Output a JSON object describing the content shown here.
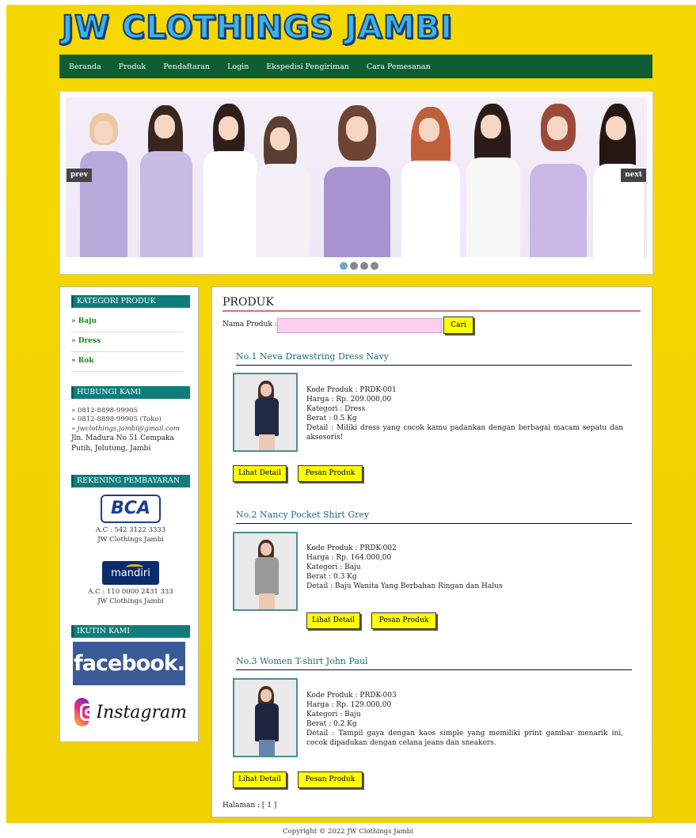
{
  "site": {
    "logo": "JW CLOTHINGS JAMBI"
  },
  "nav": {
    "items": [
      "Beranda",
      "Produk",
      "Pendaftaran",
      "Login",
      "Ekspedisi Pengiriman",
      "Cara Pemesanan"
    ]
  },
  "slider": {
    "prev_label": "prev",
    "next_label": "next",
    "slide_count": 4,
    "active_slide": 1
  },
  "sidebar": {
    "category_heading": "KATEGORI PRODUK",
    "categories": [
      "» Baju",
      "» Dress",
      "» Rok"
    ],
    "contact_heading": "HUBUNGI KAMI",
    "phone1": "» 0812-8898-99905",
    "phone2": "» 0812-8898-99905 (Toko)",
    "email": "» jwclothings.jambi@gmail.com",
    "address": "Jln. Madura No 51 Cempaka Putih, Jelutung, Jambi",
    "bank_heading": "REKENING PEMBAYARAN",
    "bca_logo": "BCA",
    "bca_account": "A.C : 542 3122 3333",
    "bca_name": "JW Clothings Jambi",
    "mandiri_logo": "mandiri",
    "mandiri_account": "A.C : 110 0000 2431 333",
    "mandiri_name": "JW Clothings Jambi",
    "follow_heading": "IKUTIN KAMI",
    "facebook_logo": "facebook.",
    "instagram_logo": "Instagram"
  },
  "main": {
    "title": "PRODUK",
    "search_label": "Nama Produk :",
    "search_value": "",
    "search_button": "Cari",
    "detail_button": "Lihat Detail",
    "order_button": "Pesan Produk",
    "pagination": "Halaman : [ 1 ]",
    "products": [
      {
        "title": "No.1 Neva Drawstring Dress Navy",
        "kode": "Kode Produk : PRDK-001",
        "harga": "Harga : Rp. 209.000,00",
        "kategori": "Kategori : Dress",
        "berat": "Berat : 0.5 Kg",
        "detail": "Detail : Miliki dress yang cocok kamu padankan dengan berbagai macam sepatu dan aksesoris!",
        "color": "#1f2a44"
      },
      {
        "title": "No.2 Nancy Pocket Shirt Grey",
        "kode": "Kode Produk : PRDK-002",
        "harga": "Harga : Rp. 164.000,00",
        "kategori": "Kategori : Baju",
        "berat": "Berat : 0.3 Kg",
        "detail": "Detail : Baju Wanita Yang Berbahan Ringan dan Halus",
        "color": "#9a9a9a"
      },
      {
        "title": "No.3 Women T-shirt John Paul",
        "kode": "Kode Produk : PRDK-003",
        "harga": "Harga : Rp. 129.000,00",
        "kategori": "Kategori : Baju",
        "berat": "Berat : 0.2 Kg",
        "detail": "Detail : Tampil gaya dengan kaos simple yang memiliki print gambar menarik ini, cocok dipadukan dengan celana jeans dan sneakers.",
        "color": "#1d2540"
      }
    ]
  },
  "footer": {
    "copyright": "Copyright © 2022 JW Clothings Jambi"
  }
}
